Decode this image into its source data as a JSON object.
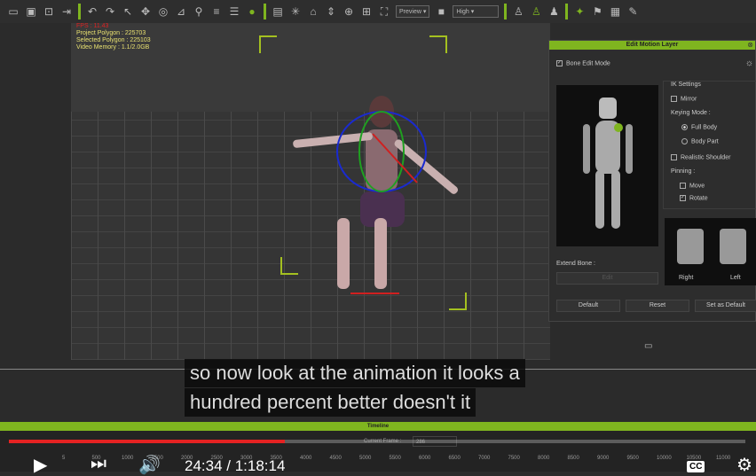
{
  "toolbar": {
    "preview_select": "Preview",
    "quality_select": "High"
  },
  "stats": {
    "fps": "FPS : 11.43",
    "project_polygon": "Project Polygon : 225703",
    "selected_polygon": "Selected Polygon : 225103",
    "video_memory": "Video Memory : 1.1/2.0GB"
  },
  "panel": {
    "title": "Edit Motion Layer",
    "bone_edit_mode": "Bone Edit Mode",
    "ik_settings": "IK Settings",
    "mirror": "Mirror",
    "keying_mode": "Keying Mode :",
    "full_body": "Full Body",
    "body_part": "Body Part",
    "realistic_shoulder": "Realistic Shoulder",
    "pinning": "Pinning :",
    "move": "Move",
    "rotate": "Rotate",
    "right": "Right",
    "left": "Left",
    "extend_bone": "Extend Bone :",
    "edit": "Edit",
    "default": "Default",
    "reset": "Reset",
    "set_as_default": "Set as Default"
  },
  "subtitles": {
    "line1": "so now look at the animation it looks a",
    "line2": "hundred percent better doesn't it"
  },
  "timeline": {
    "title": "Timeline",
    "current_frame_label": "Current Frame :",
    "current_frame": "286",
    "ticks": [
      "5",
      "500",
      "1000",
      "1500",
      "2000",
      "2500",
      "3000",
      "3500",
      "4000",
      "4500",
      "5000",
      "5500",
      "6000",
      "6500",
      "7000",
      "7500",
      "8000",
      "8500",
      "9000",
      "9500",
      "10000",
      "10500",
      "11000"
    ]
  },
  "player": {
    "time": "24:34 / 1:18:14",
    "progress": 0.375,
    "cc": "CC"
  }
}
